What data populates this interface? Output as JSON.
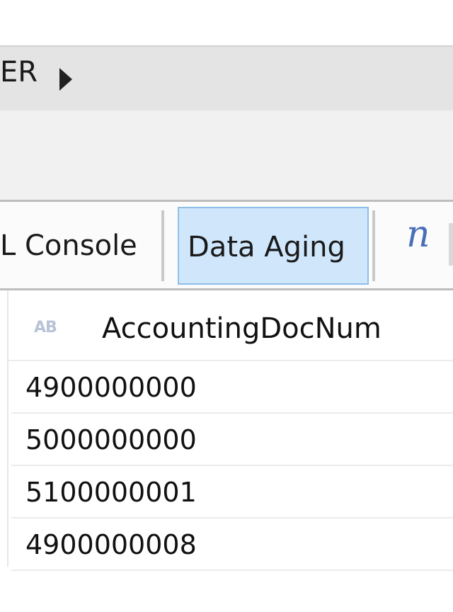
{
  "breadcrumb": {
    "text": "ER"
  },
  "toolbar": {
    "console_label": "L Console",
    "data_aging_label": "Data Aging",
    "n_icon_glyph": "n"
  },
  "grid": {
    "column_header": "AccountingDocNum",
    "column_type_glyph": "AB",
    "rows": [
      "4900000000",
      "5000000000",
      "5100000001",
      "4900000008"
    ]
  },
  "colors": {
    "selected_tab_bg": "#cfe6fb",
    "selected_tab_border": "#8fbfe8",
    "breadcrumb_bg": "#e4e4e4",
    "icon_blue": "#4a6fb8"
  }
}
